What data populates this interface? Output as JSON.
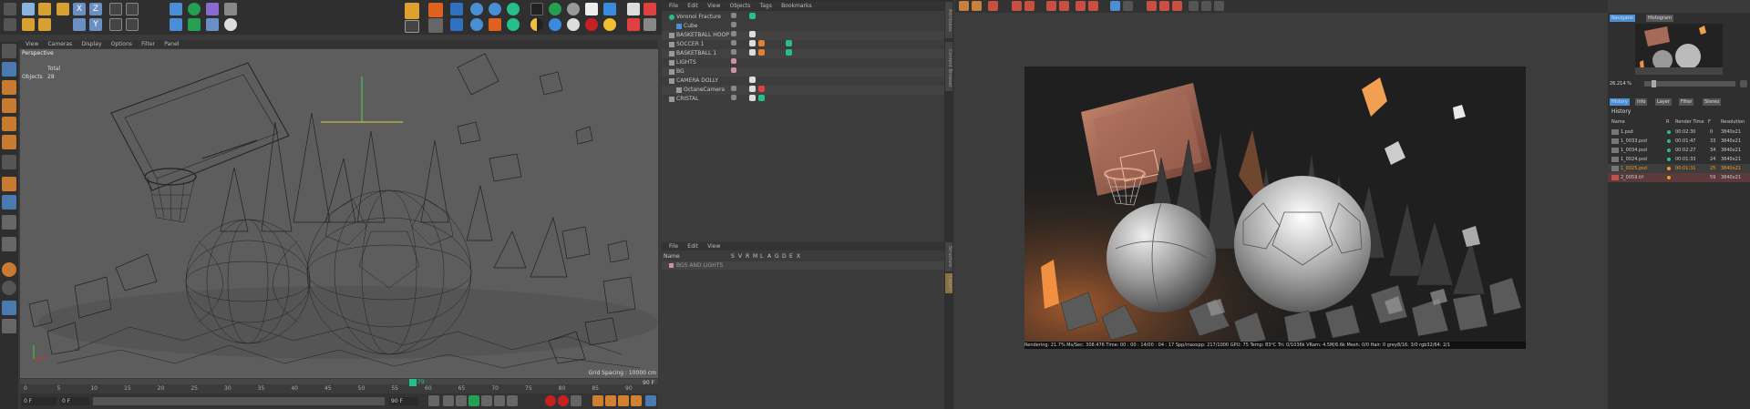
{
  "viewport": {
    "menu": [
      "View",
      "Cameras",
      "Display",
      "Options",
      "Filter",
      "Panel"
    ],
    "label": "Perspective",
    "stats_header": "Total",
    "stats_label": "Objects",
    "stats_value": "28",
    "grid_spacing": "Grid Spacing : 10000 cm"
  },
  "timeline": {
    "ticks": [
      "0",
      "5",
      "10",
      "15",
      "20",
      "25",
      "30",
      "35",
      "40",
      "45",
      "50",
      "55",
      "60",
      "65",
      "70",
      "75",
      "80",
      "85",
      "90"
    ],
    "playhead_label": "79",
    "end_frame": "90 F",
    "current_frame": "0 F",
    "start_field": "0 F",
    "end_field": "90 F",
    "current_right": "0 F"
  },
  "object_manager": {
    "menu": [
      "File",
      "Edit",
      "View",
      "Objects",
      "Tags",
      "Bookmarks"
    ],
    "rows": [
      {
        "name": "Voronoi Fracture"
      },
      {
        "name": "Cube"
      },
      {
        "name": "BASKETBALL HOOP"
      },
      {
        "name": "SOCCER 1"
      },
      {
        "name": "BASKETBALL 1"
      },
      {
        "name": "LIGHTS"
      },
      {
        "name": "BG"
      },
      {
        "name": "CAMERA DOLLY"
      },
      {
        "name": "OctaneCamera"
      },
      {
        "name": "CRISTAL"
      }
    ]
  },
  "layer_manager": {
    "menu": [
      "File",
      "Edit",
      "View"
    ],
    "columns": [
      "Name",
      "S",
      "V",
      "R",
      "M",
      "L",
      "A",
      "G",
      "D",
      "E",
      "X"
    ],
    "rows": [
      {
        "name": "BGS AND LIGHTS"
      }
    ]
  },
  "render_status": "Rendering: 21.7%  Ms/Sec: 308.476  Time: 00 : 00 : 14/00 : 04 : 17  Spp/maxspp: 217/1000  GPU: 75  Temp: 83°C  Tri: 0/1036k  VRam: 4.5M/6.6k  Mesh: 0/0  Hair: 0  grey8/16: 3/0  rgb32/64: 2/1",
  "side_tabs": [
    "Attributes",
    "Take",
    "Content Browser",
    "Structure",
    "Layers"
  ],
  "navigator": {
    "tabs": [
      "Navigator",
      "Histogram"
    ],
    "zoom": "26.214 %"
  },
  "history": {
    "tabs": [
      "History",
      "Info",
      "Layer",
      "Filter",
      "Stereo"
    ],
    "title": "History",
    "columns": [
      "Name",
      "R",
      "Render Time",
      "F",
      "Resolution"
    ],
    "rows": [
      {
        "name": "1.psd",
        "time": "00:02:30",
        "frame": "0",
        "res": "3840x21",
        "color": "#25c08a"
      },
      {
        "name": "1_0033.psd",
        "time": "00:01:47",
        "frame": "33",
        "res": "3840x21",
        "color": "#25c08a"
      },
      {
        "name": "1_0034.psd",
        "time": "00:02:27",
        "frame": "34",
        "res": "3840x21",
        "color": "#25c08a"
      },
      {
        "name": "1_0024.psd",
        "time": "00:01:33",
        "frame": "24",
        "res": "3840x21",
        "color": "#25c08a"
      },
      {
        "name": "1_0025.psd",
        "time": "00:01:31",
        "frame": "25",
        "res": "3840x21",
        "color": "#e8a020"
      },
      {
        "name": "2_0059.tif",
        "time": "",
        "frame": "59",
        "res": "3840x21",
        "color": "#e8a020"
      }
    ]
  },
  "colors": {
    "accent": "#4a8fd6",
    "status_green": "#25c08a",
    "status_orange": "#e8a020",
    "axis_yellow": "#d6d23a",
    "render_orange": "#f0a050"
  }
}
